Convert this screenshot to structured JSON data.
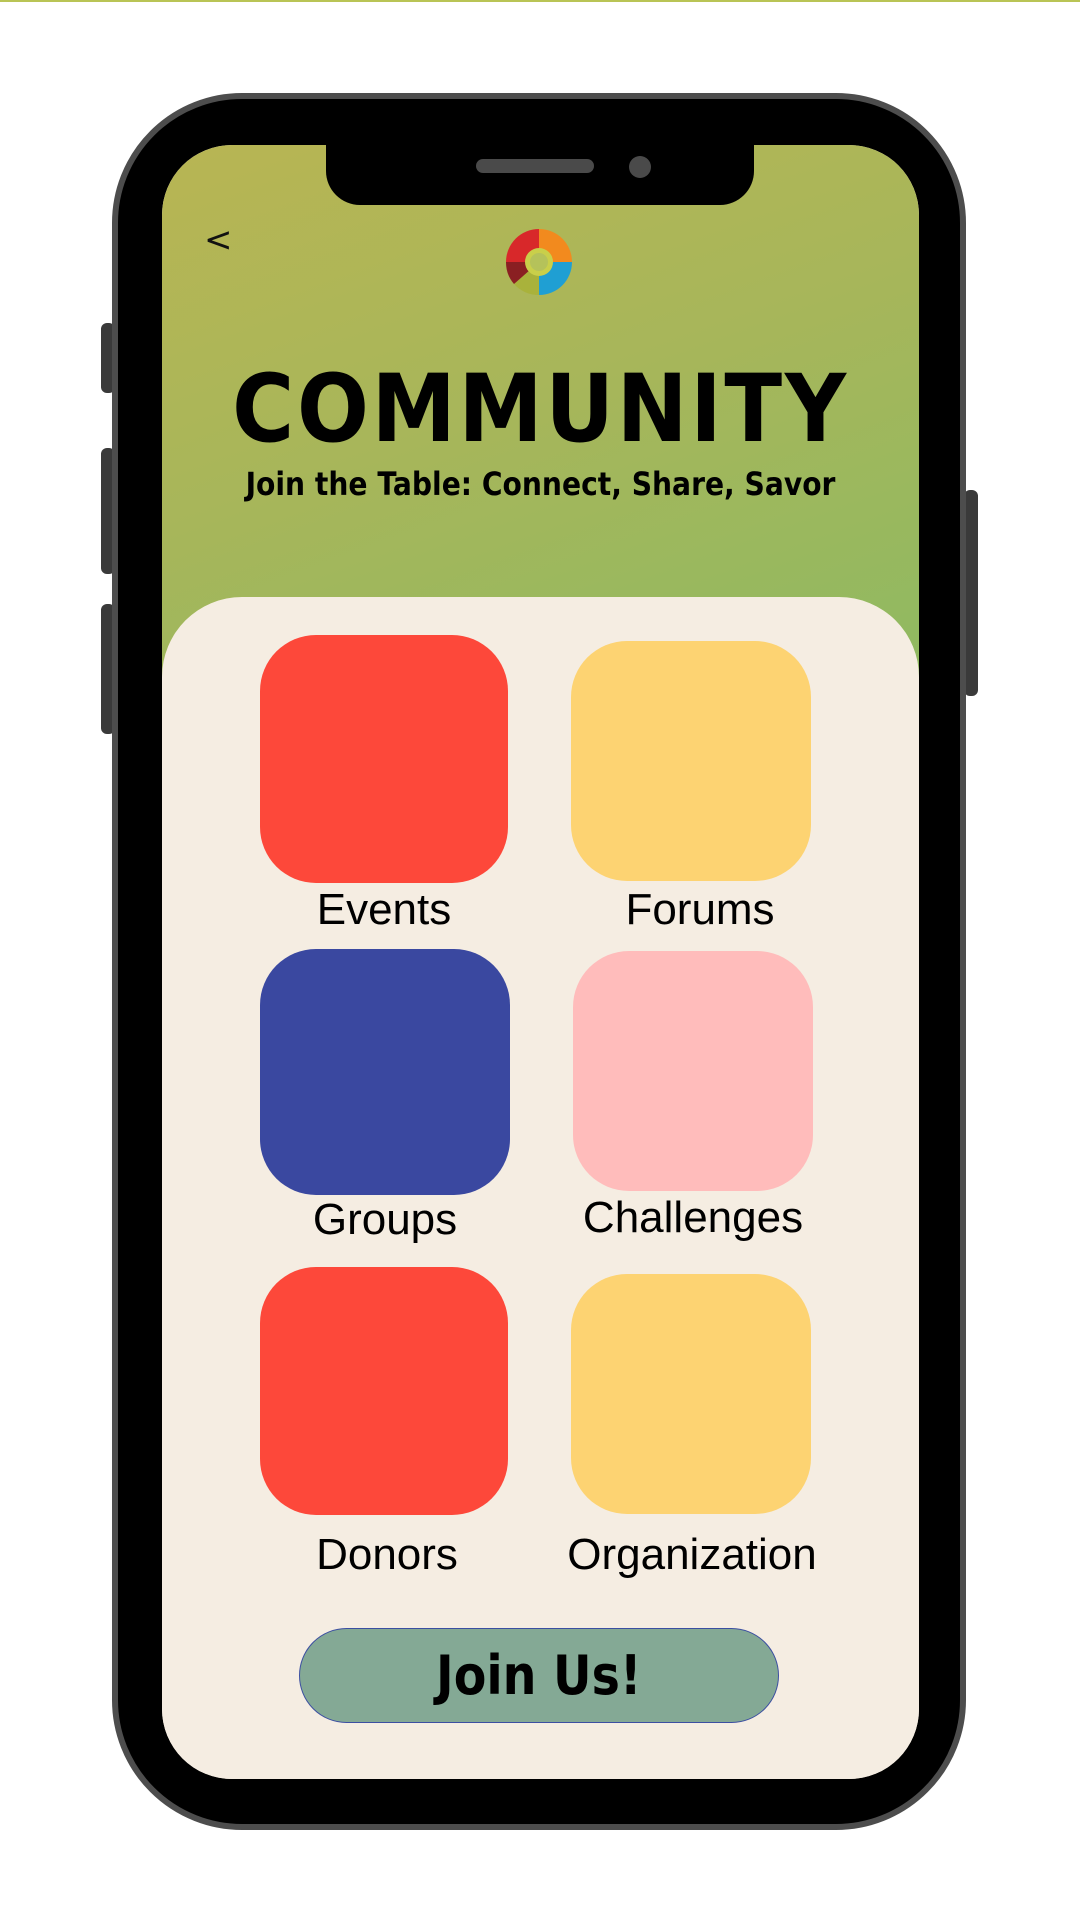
{
  "header": {
    "back_label": "<",
    "title": "COMMUNITY",
    "subtitle": "Join the Table: Connect, Share, Savor",
    "logo_icon": "community-logo-icon"
  },
  "tiles": [
    {
      "label": "Events",
      "color": "#fd483a"
    },
    {
      "label": "Forums",
      "color": "#fdd372"
    },
    {
      "label": "Groups",
      "color": "#3a48a0"
    },
    {
      "label": "Challenges",
      "color": "#ffbcbb"
    },
    {
      "label": "Donors",
      "color": "#fd483a"
    },
    {
      "label": "Organization",
      "color": "#fdd372"
    }
  ],
  "cta": {
    "label": "Join Us!",
    "color": "#84a995"
  },
  "colors": {
    "header_gradient_start": "#b8b553",
    "header_gradient_end": "#86bb64",
    "content_background": "#f5ede2"
  }
}
